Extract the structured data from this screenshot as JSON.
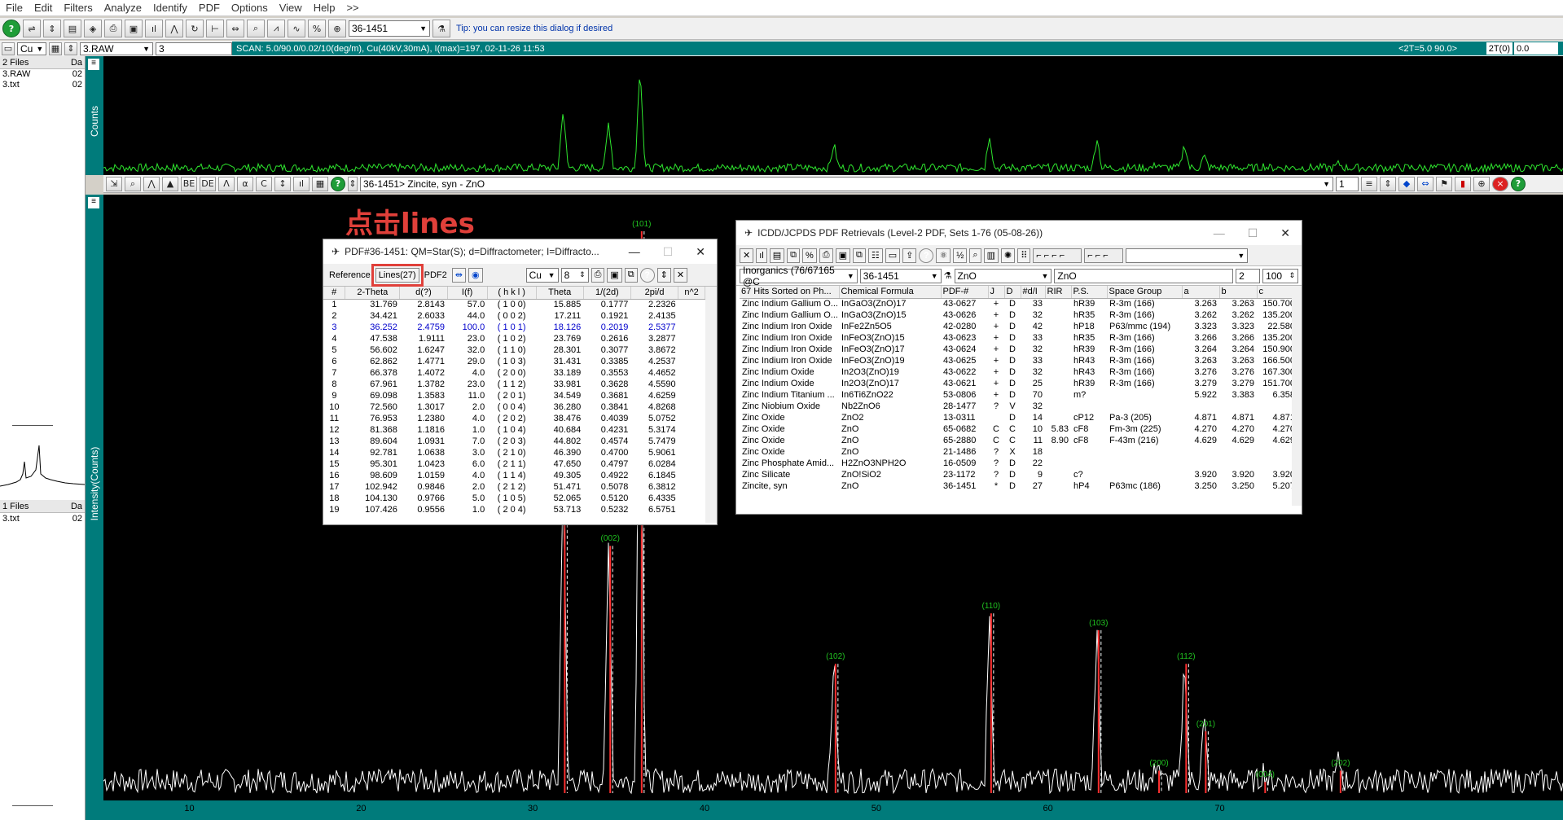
{
  "menu": [
    "File",
    "Edit",
    "Filters",
    "Analyze",
    "Identify",
    "PDF",
    "Options",
    "View",
    "Help",
    ">>"
  ],
  "toolbar": {
    "pdf_number": "36-1451",
    "tip": "Tip: you can resize this dialog if desired"
  },
  "toolbar2": {
    "element": "Cu",
    "file": "3.RAW",
    "value": "3"
  },
  "scan_info": "SCAN: 5.0/90.0/0.02/10(deg/m), Cu(40kV,30mA), I(max)=197, 02-11-26 11:53",
  "scan_right": "<2T=5.0 90.0>",
  "two_theta_label": "2T(0)",
  "two_theta_value": "0.0",
  "left_panel": {
    "files_header": "2 Files",
    "col_header": "Da",
    "files": [
      {
        "name": "3.RAW",
        "date": "02"
      },
      {
        "name": "3.txt",
        "date": "02"
      }
    ],
    "files2_header": "1 Files",
    "col2_header": "Da",
    "files2": [
      {
        "name": "3.txt",
        "date": "02"
      }
    ]
  },
  "axis_labels": {
    "top_y": "Counts",
    "main_y": "Intensity(Counts)"
  },
  "mid_toolbar": {
    "phase": "36-1451> Zincite, syn - ZnO",
    "page": "1"
  },
  "annotation": "点击lines",
  "pdf_dialog": {
    "title": "PDF#36-1451: QM=Star(S); d=Diffractometer; I=Diffracto...",
    "reference_label": "Reference",
    "lines_button": "Lines(27)",
    "pdf2_button": "PDF2",
    "element": "Cu",
    "count": "8",
    "columns": [
      "#",
      "2-Theta",
      "d(?)",
      "I(f)",
      "( h k l )",
      "Theta",
      "1/(2d)",
      "2pi/d",
      "n^2"
    ],
    "rows": [
      [
        "1",
        "31.769",
        "2.8143",
        "57.0",
        "( 1 0 0)",
        "15.885",
        "0.1777",
        "2.2326",
        ""
      ],
      [
        "2",
        "34.421",
        "2.6033",
        "44.0",
        "( 0 0 2)",
        "17.211",
        "0.1921",
        "2.4135",
        ""
      ],
      [
        "3",
        "36.252",
        "2.4759",
        "100.0",
        "( 1 0 1)",
        "18.126",
        "0.2019",
        "2.5377",
        ""
      ],
      [
        "4",
        "47.538",
        "1.9111",
        "23.0",
        "( 1 0 2)",
        "23.769",
        "0.2616",
        "3.2877",
        ""
      ],
      [
        "5",
        "56.602",
        "1.6247",
        "32.0",
        "( 1 1 0)",
        "28.301",
        "0.3077",
        "3.8672",
        ""
      ],
      [
        "6",
        "62.862",
        "1.4771",
        "29.0",
        "( 1 0 3)",
        "31.431",
        "0.3385",
        "4.2537",
        ""
      ],
      [
        "7",
        "66.378",
        "1.4072",
        "4.0",
        "( 2 0 0)",
        "33.189",
        "0.3553",
        "4.4652",
        ""
      ],
      [
        "8",
        "67.961",
        "1.3782",
        "23.0",
        "( 1 1 2)",
        "33.981",
        "0.3628",
        "4.5590",
        ""
      ],
      [
        "9",
        "69.098",
        "1.3583",
        "11.0",
        "( 2 0 1)",
        "34.549",
        "0.3681",
        "4.6259",
        ""
      ],
      [
        "10",
        "72.560",
        "1.3017",
        "2.0",
        "( 0 0 4)",
        "36.280",
        "0.3841",
        "4.8268",
        ""
      ],
      [
        "11",
        "76.953",
        "1.2380",
        "4.0",
        "( 2 0 2)",
        "38.476",
        "0.4039",
        "5.0752",
        ""
      ],
      [
        "12",
        "81.368",
        "1.1816",
        "1.0",
        "( 1 0 4)",
        "40.684",
        "0.4231",
        "5.3174",
        ""
      ],
      [
        "13",
        "89.604",
        "1.0931",
        "7.0",
        "( 2 0 3)",
        "44.802",
        "0.4574",
        "5.7479",
        ""
      ],
      [
        "14",
        "92.781",
        "1.0638",
        "3.0",
        "( 2 1 0)",
        "46.390",
        "0.4700",
        "5.9061",
        ""
      ],
      [
        "15",
        "95.301",
        "1.0423",
        "6.0",
        "( 2 1 1)",
        "47.650",
        "0.4797",
        "6.0284",
        ""
      ],
      [
        "16",
        "98.609",
        "1.0159",
        "4.0",
        "( 1 1 4)",
        "49.305",
        "0.4922",
        "6.1845",
        ""
      ],
      [
        "17",
        "102.942",
        "0.9846",
        "2.0",
        "( 2 1 2)",
        "51.471",
        "0.5078",
        "6.3812",
        ""
      ],
      [
        "18",
        "104.130",
        "0.9766",
        "5.0",
        "( 1 0 5)",
        "52.065",
        "0.5120",
        "6.4335",
        ""
      ],
      [
        "19",
        "107.426",
        "0.9556",
        "1.0",
        "( 2 0 4)",
        "53.713",
        "0.5232",
        "6.5751",
        ""
      ]
    ]
  },
  "hits_dialog": {
    "title": "ICDD/JCPDS PDF Retrievals (Level-2 PDF, Sets 1-76 (05-08-26))",
    "filter_combo": "Inorganics (76/67165 @C",
    "pdf_combo": "36-1451",
    "formula_combo": "ZnO",
    "formula_field": "ZnO",
    "num1": "2",
    "num2": "100",
    "columns": [
      "67 Hits Sorted on Ph...",
      "Chemical Formula",
      "PDF-#",
      "J",
      "D",
      "#d/I",
      "RIR",
      "P.S.",
      "Space Group",
      "a",
      "b",
      "c"
    ],
    "rows": [
      [
        "Zinc Indium Gallium O...",
        "InGaO3(ZnO)17",
        "43-0627",
        "+",
        "D",
        "33",
        "",
        "hR39",
        "R-3m (166)",
        "3.263",
        "3.263",
        "150.700"
      ],
      [
        "Zinc Indium Gallium O...",
        "InGaO3(ZnO)15",
        "43-0626",
        "+",
        "D",
        "32",
        "",
        "hR35",
        "R-3m (166)",
        "3.262",
        "3.262",
        "135.200"
      ],
      [
        "Zinc Indium Iron Oxide",
        "InFe2Zn5O5",
        "42-0280",
        "+",
        "D",
        "42",
        "",
        "hP18",
        "P63/mmc (194)",
        "3.323",
        "3.323",
        "22.580"
      ],
      [
        "Zinc Indium Iron Oxide",
        "InFeO3(ZnO)15",
        "43-0623",
        "+",
        "D",
        "33",
        "",
        "hR35",
        "R-3m (166)",
        "3.266",
        "3.266",
        "135.200"
      ],
      [
        "Zinc Indium Iron Oxide",
        "InFeO3(ZnO)17",
        "43-0624",
        "+",
        "D",
        "32",
        "",
        "hR39",
        "R-3m (166)",
        "3.264",
        "3.264",
        "150.900"
      ],
      [
        "Zinc Indium Iron Oxide",
        "InFeO3(ZnO)19",
        "43-0625",
        "+",
        "D",
        "33",
        "",
        "hR43",
        "R-3m (166)",
        "3.263",
        "3.263",
        "166.500"
      ],
      [
        "Zinc Indium Oxide",
        "In2O3(ZnO)19",
        "43-0622",
        "+",
        "D",
        "32",
        "",
        "hR43",
        "R-3m (166)",
        "3.276",
        "3.276",
        "167.300"
      ],
      [
        "Zinc Indium Oxide",
        "In2O3(ZnO)17",
        "43-0621",
        "+",
        "D",
        "25",
        "",
        "hR39",
        "R-3m (166)",
        "3.279",
        "3.279",
        "151.700"
      ],
      [
        "Zinc Indium Titanium ...",
        "In6Ti6ZnO22",
        "53-0806",
        "+",
        "D",
        "70",
        "",
        "m?",
        "",
        "5.922",
        "3.383",
        "6.358"
      ],
      [
        "Zinc Niobium Oxide",
        "Nb2ZnO6",
        "28-1477",
        "?",
        "V",
        "32",
        "",
        "",
        "",
        "",
        "",
        ""
      ],
      [
        "Zinc Oxide",
        "ZnO2",
        "13-0311",
        "",
        "D",
        "14",
        "",
        "cP12",
        "Pa-3 (205)",
        "4.871",
        "4.871",
        "4.871"
      ],
      [
        "Zinc Oxide",
        "ZnO",
        "65-0682",
        "C",
        "C",
        "10",
        "5.83",
        "cF8",
        "Fm-3m (225)",
        "4.270",
        "4.270",
        "4.270"
      ],
      [
        "Zinc Oxide",
        "ZnO",
        "65-2880",
        "C",
        "C",
        "11",
        "8.90",
        "cF8",
        "F-43m (216)",
        "4.629",
        "4.629",
        "4.629"
      ],
      [
        "Zinc Oxide",
        "ZnO",
        "21-1486",
        "?",
        "X",
        "18",
        "",
        "",
        "",
        "",
        "",
        ""
      ],
      [
        "Zinc Phosphate Amid...",
        "H2ZnO3NPH2O",
        "16-0509",
        "?",
        "D",
        "22",
        "",
        "",
        "",
        "",
        "",
        ""
      ],
      [
        "Zinc Silicate",
        "ZnO!SiO2",
        "23-1172",
        "?",
        "D",
        "9",
        "",
        "c?",
        "",
        "3.920",
        "3.920",
        "3.920"
      ],
      [
        "Zincite, syn",
        "ZnO",
        "36-1451",
        "*",
        "D",
        "27",
        "",
        "hP4",
        "P63mc (186)",
        "3.250",
        "3.250",
        "5.207"
      ]
    ]
  },
  "chart_data": {
    "type": "line",
    "xlim": [
      5,
      90
    ],
    "xlabel": "",
    "ylabel": "Intensity(Counts)",
    "x_ticks": [
      10,
      20,
      30,
      40,
      50,
      60,
      70
    ],
    "peak_labels": [
      {
        "label": "(101)",
        "x": 36.25
      },
      {
        "label": "(002)",
        "x": 34.42
      },
      {
        "label": "(102)",
        "x": 47.54
      },
      {
        "label": "(110)",
        "x": 56.6
      },
      {
        "label": "(103)",
        "x": 62.86
      },
      {
        "label": "(112)",
        "x": 67.96
      },
      {
        "label": "(201)",
        "x": 69.1
      },
      {
        "label": "(200)",
        "x": 66.38
      },
      {
        "label": "(004)",
        "x": 72.56
      },
      {
        "label": "(202)",
        "x": 76.95
      }
    ],
    "reference_sticks": [
      {
        "x": 31.77,
        "i": 57
      },
      {
        "x": 34.42,
        "i": 44
      },
      {
        "x": 36.25,
        "i": 100
      },
      {
        "x": 47.54,
        "i": 23
      },
      {
        "x": 56.6,
        "i": 32
      },
      {
        "x": 62.86,
        "i": 29
      },
      {
        "x": 66.38,
        "i": 4
      },
      {
        "x": 67.96,
        "i": 23
      },
      {
        "x": 69.1,
        "i": 11
      },
      {
        "x": 72.56,
        "i": 2
      },
      {
        "x": 76.95,
        "i": 4
      }
    ]
  }
}
